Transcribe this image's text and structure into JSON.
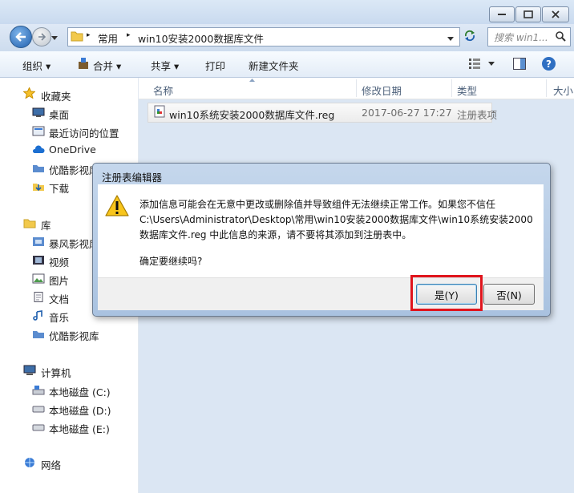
{
  "breadcrumb": {
    "root": "常用",
    "current": "win10安装2000数据库文件"
  },
  "search": {
    "placeholder": "搜索 win1..."
  },
  "toolbar": {
    "organize": "组织 ▾",
    "include": "合并 ▾",
    "share": "共享 ▾",
    "print": "打印",
    "new_folder": "新建文件夹"
  },
  "nav": {
    "favorites": "收藏夹",
    "fav_items": [
      "桌面",
      "最近访问的位置",
      "OneDrive",
      "优酷影视库",
      "下载"
    ],
    "libraries": "库",
    "lib_items": [
      "暴风影视库",
      "视频",
      "图片",
      "文档",
      "音乐",
      "优酷影视库"
    ],
    "computer": "计算机",
    "drives": [
      "本地磁盘 (C:)",
      "本地磁盘 (D:)",
      "本地磁盘 (E:)"
    ],
    "network": "网络"
  },
  "columns": {
    "name": "名称",
    "date": "修改日期",
    "type": "类型",
    "size": "大小"
  },
  "file": {
    "name": "win10系统安装2000数据库文件.reg",
    "date": "2017-06-27 17:27",
    "type": "注册表项"
  },
  "dialog": {
    "title": "注册表编辑器",
    "line1": "添加信息可能会在无意中更改或删除值并导致组件无法继续正常工作。如果您不信任",
    "line2": "C:\\Users\\Administrator\\Desktop\\常用\\win10安装2000数据库文件\\win10系统安装2000",
    "line3": "数据库文件.reg 中此信息的来源，请不要将其添加到注册表中。",
    "question": "确定要继续吗?",
    "yes": "是(Y)",
    "no": "否(N)"
  },
  "colors": {
    "highlight": "#e0141c",
    "accent": "#3c7fb1"
  }
}
